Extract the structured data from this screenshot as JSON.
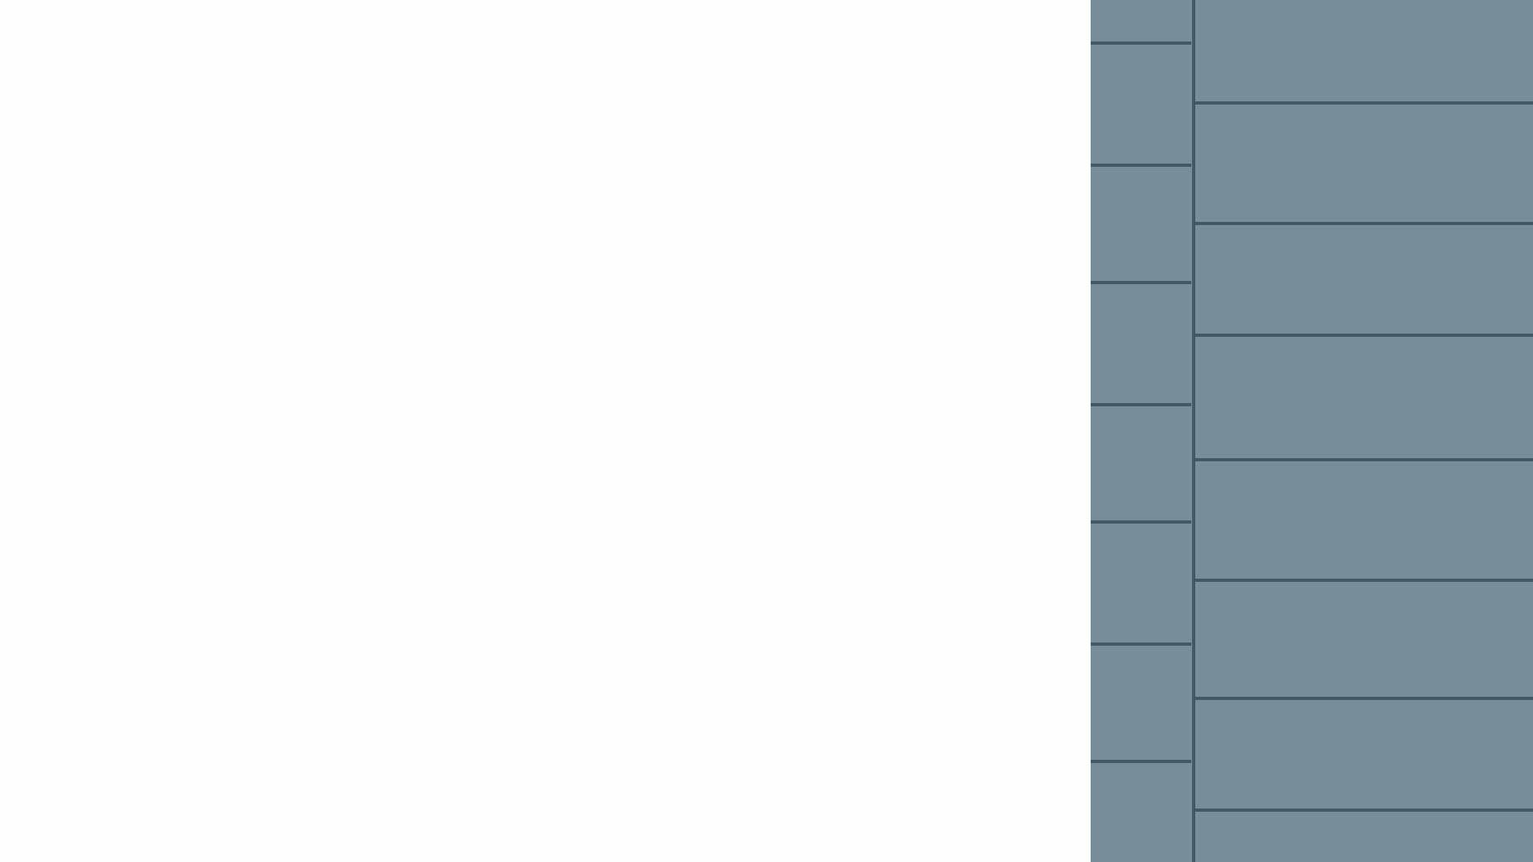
{
  "title": "",
  "colors": {
    "background": "#fefefe",
    "panel": "#778d99",
    "separator": "#435866"
  },
  "left_column": {
    "rows": 8
  },
  "right_column": {
    "rows": 8
  }
}
